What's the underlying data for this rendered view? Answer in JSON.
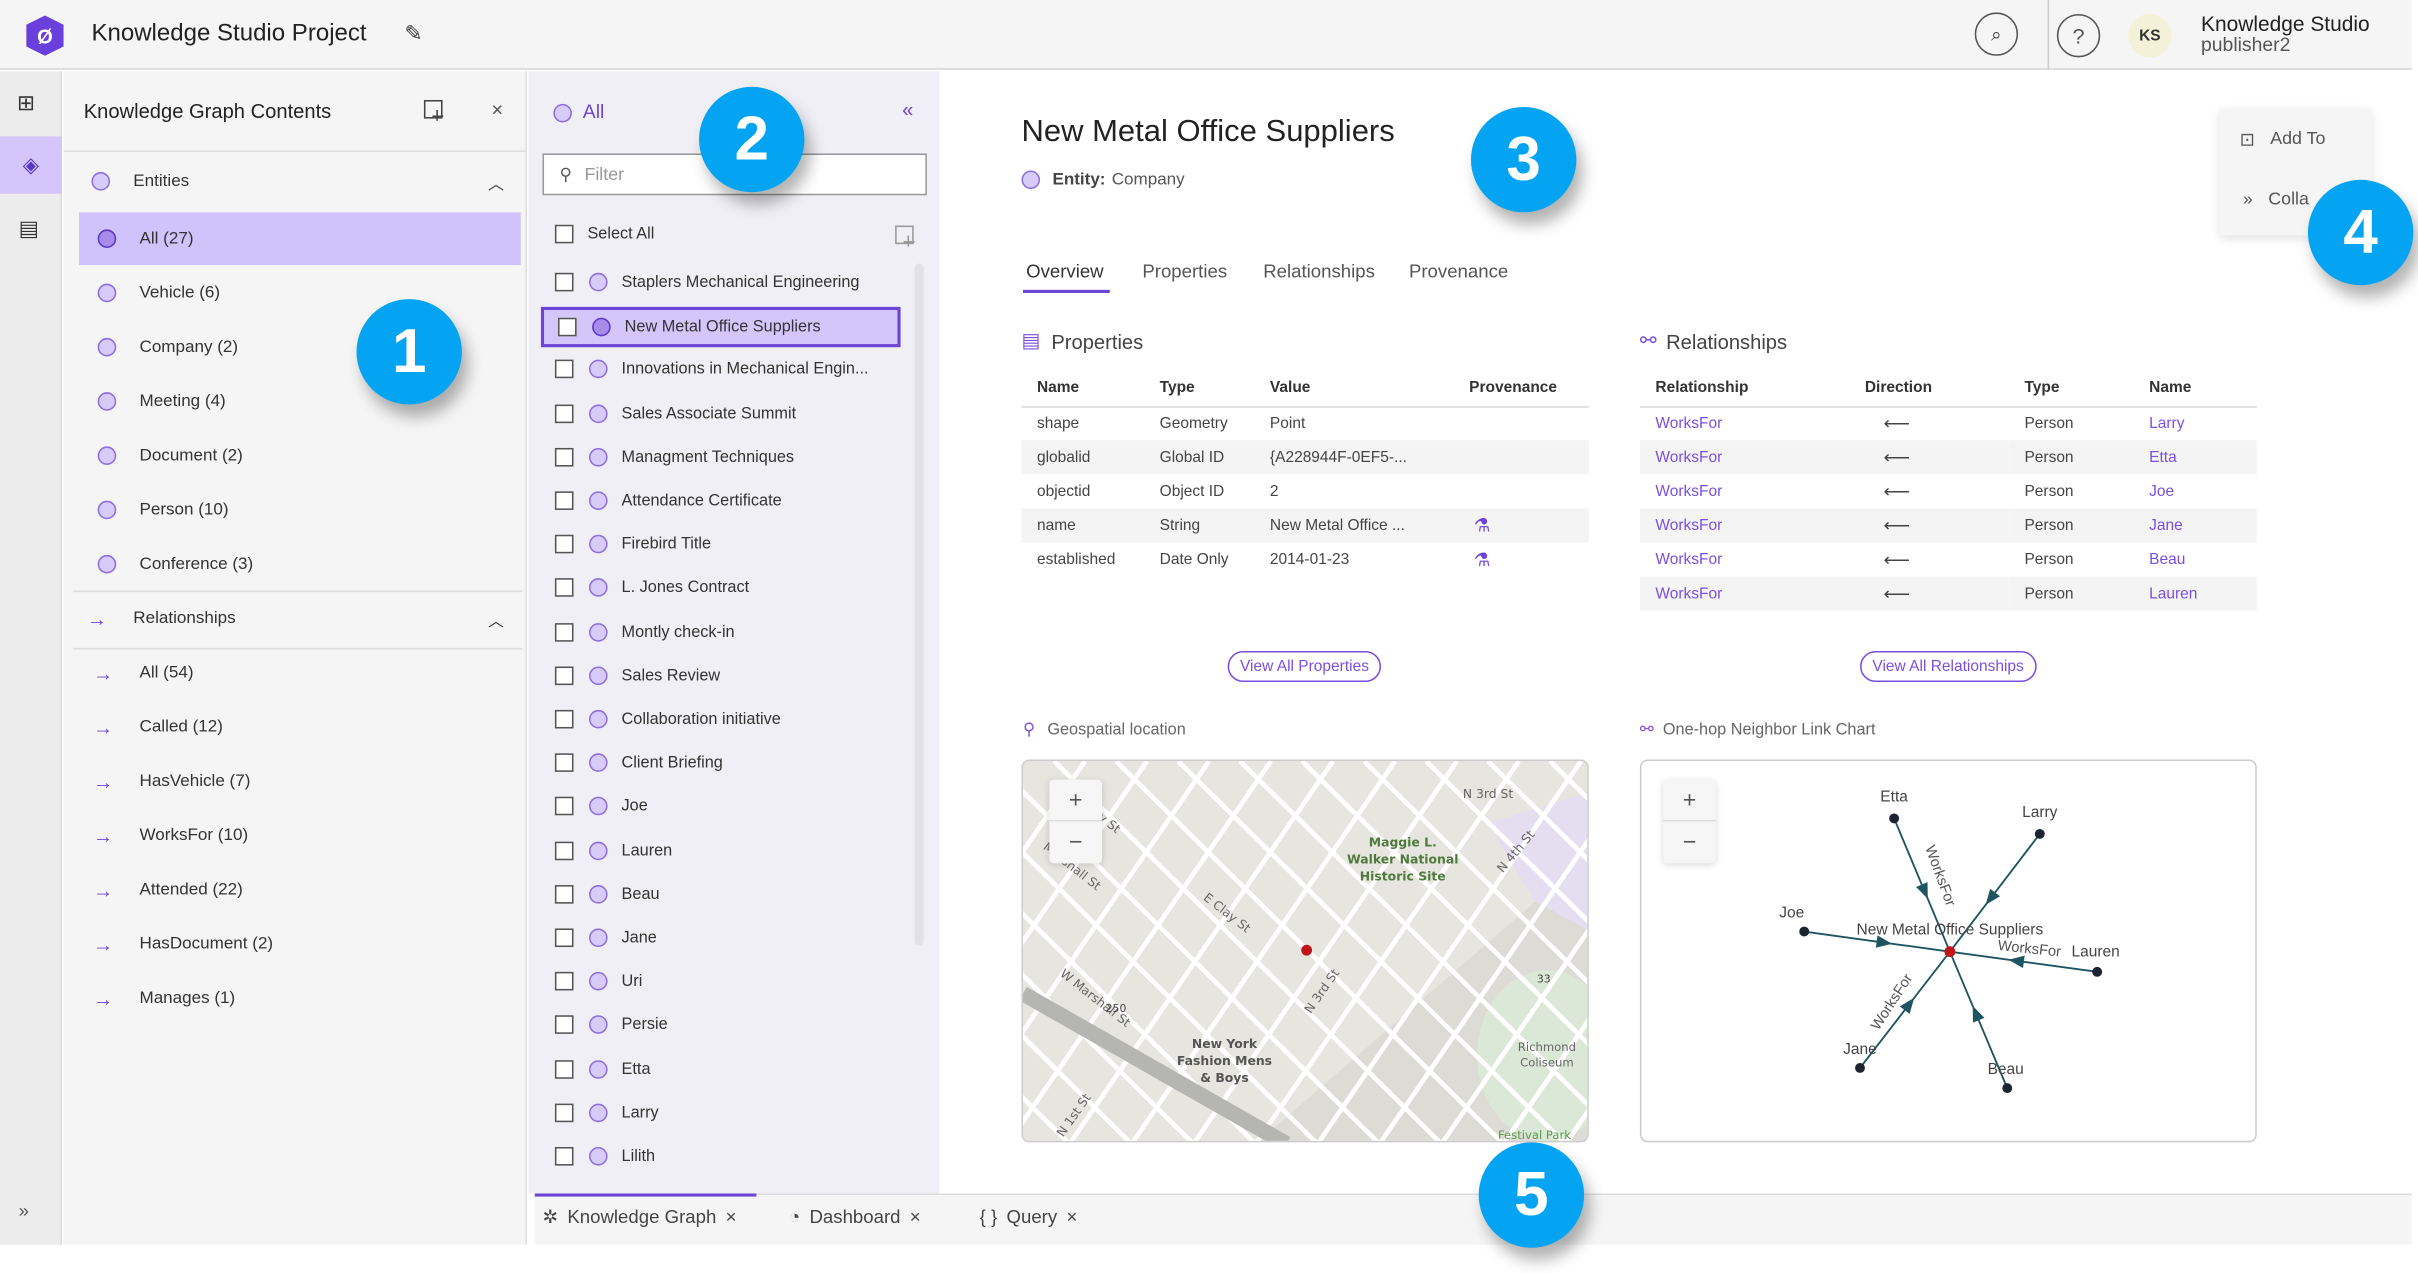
{
  "header": {
    "title": "Knowledge Studio Project",
    "user_initials": "KS",
    "user_name": "Knowledge Studio",
    "user_role": "publisher2"
  },
  "contents_panel": {
    "title": "Knowledge Graph Contents",
    "entities_label": "Entities",
    "entities": [
      "All (27)",
      "Vehicle (6)",
      "Company (2)",
      "Meeting (4)",
      "Document (2)",
      "Person (10)",
      "Conference (3)"
    ],
    "selected_entity": "All (27)",
    "relationships_label": "Relationships",
    "relationships": [
      "All (54)",
      "Called (12)",
      "HasVehicle (7)",
      "WorksFor (10)",
      "Attended (22)",
      "HasDocument (2)",
      "Manages (1)"
    ]
  },
  "list_panel": {
    "title": "All",
    "filter_placeholder": "Filter",
    "select_all": "Select All",
    "items": [
      "Staplers Mechanical Engineering",
      "New Metal Office Suppliers",
      "Innovations in Mechanical Engin...",
      "Sales Associate Summit",
      "Managment Techniques",
      "Attendance Certificate",
      "Firebird Title",
      "L. Jones Contract",
      "Montly check-in",
      "Sales Review",
      "Collaboration initiative",
      "Client Briefing",
      "Joe",
      "Lauren",
      "Beau",
      "Jane",
      "Uri",
      "Persie",
      "Etta",
      "Larry",
      "Lilith"
    ],
    "selected_item": "New Metal Office Suppliers"
  },
  "detail": {
    "title": "New Metal Office Suppliers",
    "entity_label": "Entity:",
    "entity_type": "Company",
    "tabs": [
      "Overview",
      "Properties",
      "Relationships",
      "Provenance"
    ],
    "active_tab": "Overview",
    "properties": {
      "title": "Properties",
      "columns": [
        "Name",
        "Type",
        "Value",
        "Provenance"
      ],
      "rows": [
        {
          "name": "shape",
          "type": "Geometry",
          "value": "Point",
          "provenance": false
        },
        {
          "name": "globalid",
          "type": "Global ID",
          "value": "{A228944F-0EF5-...",
          "provenance": false
        },
        {
          "name": "objectid",
          "type": "Object ID",
          "value": "2",
          "provenance": false
        },
        {
          "name": "name",
          "type": "String",
          "value": "New Metal Office ...",
          "provenance": true
        },
        {
          "name": "established",
          "type": "Date Only",
          "value": "2014-01-23",
          "provenance": true
        }
      ],
      "view_all": "View All Properties"
    },
    "relationships": {
      "title": "Relationships",
      "columns": [
        "Relationship",
        "Direction",
        "Type",
        "Name"
      ],
      "rows": [
        {
          "relationship": "WorksFor",
          "direction": "⟵",
          "type": "Person",
          "name": "Larry"
        },
        {
          "relationship": "WorksFor",
          "direction": "⟵",
          "type": "Person",
          "name": "Etta"
        },
        {
          "relationship": "WorksFor",
          "direction": "⟵",
          "type": "Person",
          "name": "Joe"
        },
        {
          "relationship": "WorksFor",
          "direction": "⟵",
          "type": "Person",
          "name": "Jane"
        },
        {
          "relationship": "WorksFor",
          "direction": "⟵",
          "type": "Person",
          "name": "Beau"
        },
        {
          "relationship": "WorksFor",
          "direction": "⟵",
          "type": "Person",
          "name": "Lauren"
        }
      ],
      "view_all": "View All Relationships"
    },
    "map": {
      "title": "Geospatial location",
      "labels": [
        "W Clay St",
        "E Clay St",
        "W Marshall St",
        "Marshall St",
        "N 3rd St",
        "N 3rd St",
        "N 4th St",
        "N 1st St",
        "Maggie L. Walker National Historic Site",
        "New York Fashion Mens & Boys",
        "Richmond Coliseum",
        "Festival Park",
        "250",
        "33"
      ]
    },
    "link_chart": {
      "title": "One-hop Neighbor Link Chart",
      "center": "New Metal Office Suppliers",
      "neighbors": [
        "Etta",
        "Larry",
        "Joe",
        "Lauren",
        "Jane",
        "Beau"
      ],
      "edge_label": "WorksFor",
      "visible_edge_labels": [
        "WorksFor",
        "WorksFor",
        "WorksFor"
      ]
    }
  },
  "float_menu": {
    "add_to": "Add To",
    "collapse": "Colla"
  },
  "bottom_tabs": [
    "Knowledge Graph",
    "Dashboard",
    "Query"
  ],
  "active_bottom_tab": "Knowledge Graph",
  "callouts": [
    "1",
    "2",
    "3",
    "4",
    "5"
  ],
  "colors": {
    "accent": "#7a4fe0",
    "selection": "#d4c6fb",
    "callout": "#05a4f2",
    "node_center": "#c0151a",
    "edge": "#1f5563"
  }
}
